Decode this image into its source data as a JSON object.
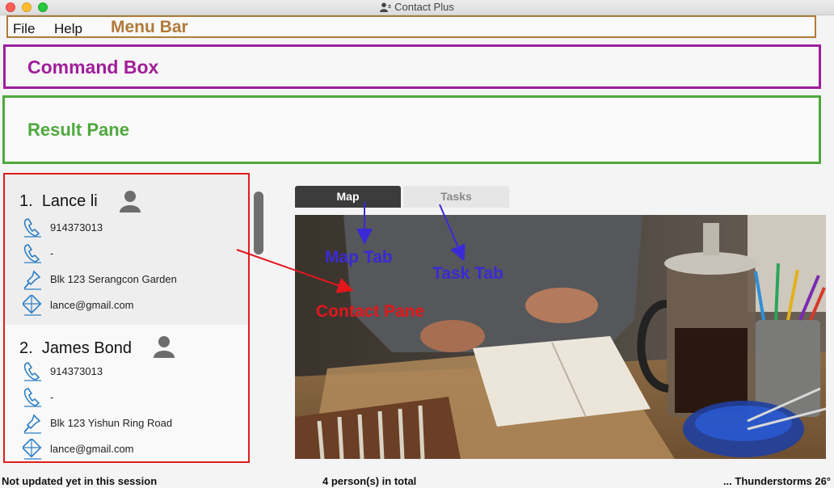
{
  "window": {
    "title": "Contact Plus",
    "title_icon": "person-icon"
  },
  "menu": {
    "file": "File",
    "help": "Help"
  },
  "annotations": {
    "menu_bar": "Menu Bar",
    "command_box": "Command Box",
    "result_pane": "Result Pane",
    "map_tab": "Map Tab",
    "task_tab": "Task Tab",
    "contact_pane": "Contact Pane"
  },
  "contacts": [
    {
      "index": "1.",
      "name": "Lance li",
      "phone": "914373013",
      "home_phone": "-",
      "address": "Blk 123 Serangcon Garden",
      "email": "lance@gmail.com"
    },
    {
      "index": "2.",
      "name": "James Bond",
      "phone": "914373013",
      "home_phone": "-",
      "address": "Blk 123 Yishun Ring Road",
      "email": "lance@gmail.com"
    }
  ],
  "tabs": {
    "map": "Map",
    "tasks": "Tasks",
    "selected": "Map"
  },
  "status": {
    "left": "Not updated yet in this session",
    "center": "4 person(s) in total",
    "right": "... Thunderstorms 26°"
  },
  "colors": {
    "menu_bar_outline": "#b07a3a",
    "command_box_outline": "#9c1f9c",
    "result_pane_outline": "#4fa83d",
    "contact_pane_outline": "#e01c1c",
    "annotation_blue": "#3a2ad6",
    "annotation_red": "#e3161b",
    "icon_blue": "#2d7fc4"
  }
}
